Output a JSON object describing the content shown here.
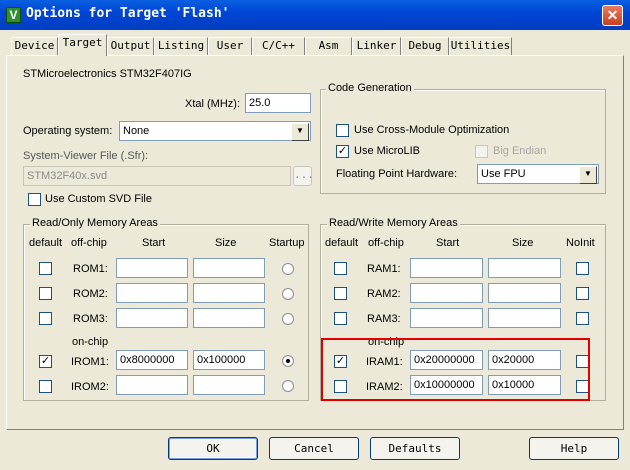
{
  "window": {
    "title": "Options for Target 'Flash'",
    "icon_letter": "V",
    "close_glyph": "✕"
  },
  "tabs": [
    {
      "label": "Device"
    },
    {
      "label": "Target"
    },
    {
      "label": "Output"
    },
    {
      "label": "Listing"
    },
    {
      "label": "User"
    },
    {
      "label": "C/C++"
    },
    {
      "label": "Asm"
    },
    {
      "label": "Linker"
    },
    {
      "label": "Debug"
    },
    {
      "label": "Utilities"
    }
  ],
  "active_tab": "Target",
  "device_name": "STMicroelectronics STM32F407IG",
  "xtal": {
    "label": "Xtal (MHz):",
    "value": "25.0"
  },
  "os": {
    "label": "Operating system:",
    "value": "None"
  },
  "sysviewer": {
    "label": "System-Viewer File (.Sfr):",
    "value": "STM32F40x.svd",
    "browse": "..."
  },
  "custom_svd": {
    "label": "Use Custom SVD File",
    "checked": false
  },
  "codegen": {
    "title": "Code Generation",
    "cross_module": {
      "label": "Use Cross-Module Optimization",
      "checked": false
    },
    "microlib": {
      "label": "Use MicroLIB",
      "checked": true,
      "mark": "✓"
    },
    "big_endian": {
      "label": "Big Endian",
      "checked": false,
      "disabled": true
    },
    "fpu": {
      "label": "Floating Point Hardware:",
      "value": "Use FPU"
    }
  },
  "rom": {
    "title": "Read/Only Memory Areas",
    "headers": {
      "default": "default",
      "offchip": "off-chip",
      "start": "Start",
      "size": "Size",
      "startup": "Startup"
    },
    "onchip_label": "on-chip",
    "rows": [
      {
        "name": "ROM1:",
        "start": "",
        "size": "",
        "default": false,
        "startup": false
      },
      {
        "name": "ROM2:",
        "start": "",
        "size": "",
        "default": false,
        "startup": false
      },
      {
        "name": "ROM3:",
        "start": "",
        "size": "",
        "default": false,
        "startup": false
      },
      {
        "name": "IROM1:",
        "start": "0x8000000",
        "size": "0x100000",
        "default": true,
        "startup": true,
        "mark": "✓"
      },
      {
        "name": "IROM2:",
        "start": "",
        "size": "",
        "default": false,
        "startup": false
      }
    ]
  },
  "ram": {
    "title": "Read/Write Memory Areas",
    "headers": {
      "default": "default",
      "offchip": "off-chip",
      "start": "Start",
      "size": "Size",
      "noinit": "NoInit"
    },
    "onchip_label": "on-chip",
    "highlight_color": "#E00000",
    "rows": [
      {
        "name": "RAM1:",
        "start": "",
        "size": "",
        "default": false,
        "noinit": false
      },
      {
        "name": "RAM2:",
        "start": "",
        "size": "",
        "default": false,
        "noinit": false
      },
      {
        "name": "RAM3:",
        "start": "",
        "size": "",
        "default": false,
        "noinit": false
      },
      {
        "name": "IRAM1:",
        "start": "0x20000000",
        "size": "0x20000",
        "default": true,
        "noinit": false,
        "mark": "✓"
      },
      {
        "name": "IRAM2:",
        "start": "0x10000000",
        "size": "0x10000",
        "default": false,
        "noinit": false
      }
    ]
  },
  "buttons": {
    "ok": "OK",
    "cancel": "Cancel",
    "defaults": "Defaults",
    "help": "Help"
  }
}
